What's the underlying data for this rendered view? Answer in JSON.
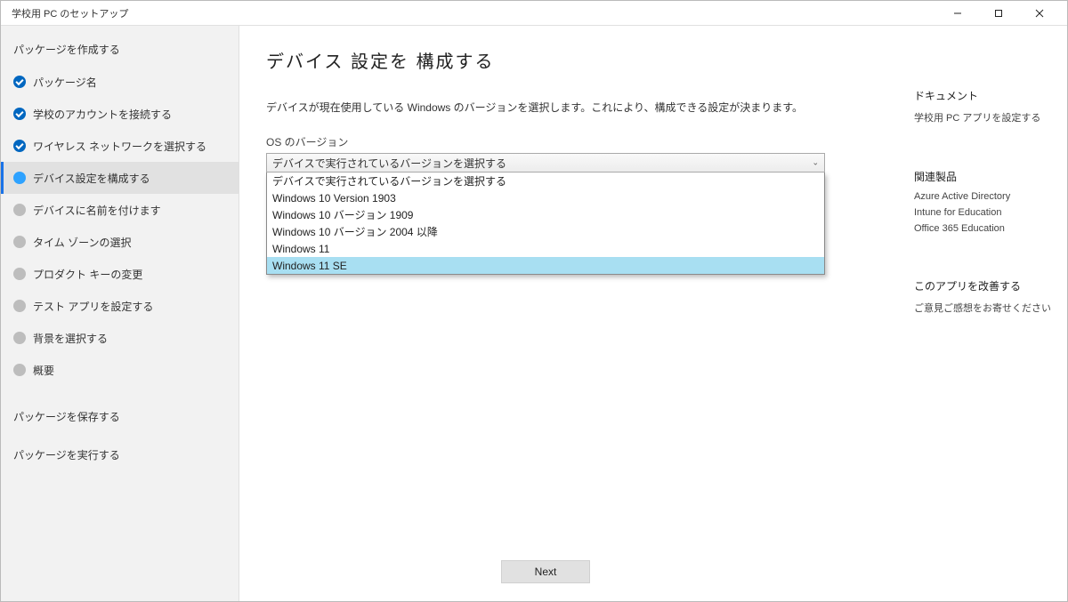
{
  "window": {
    "title": "学校用 PC のセットアップ"
  },
  "sidebar": {
    "section_create": "パッケージを作成する",
    "items": [
      {
        "label": "パッケージ名",
        "state": "done"
      },
      {
        "label": "学校のアカウントを接続する",
        "state": "done"
      },
      {
        "label": "ワイヤレス ネットワークを選択する",
        "state": "done"
      },
      {
        "label": "デバイス設定を構成する",
        "state": "current"
      },
      {
        "label": "デバイスに名前を付けます",
        "state": "pending"
      },
      {
        "label": "タイム ゾーンの選択",
        "state": "pending"
      },
      {
        "label": "プロダクト キーの変更",
        "state": "pending"
      },
      {
        "label": "テスト アプリを設定する",
        "state": "pending"
      },
      {
        "label": "背景を選択する",
        "state": "pending"
      },
      {
        "label": "概要",
        "state": "pending"
      }
    ],
    "section_save": "パッケージを保存する",
    "section_run": "パッケージを実行する"
  },
  "main": {
    "title": "デバイス 設定を 構成する",
    "desc": "デバイスが現在使用している Windows のバージョンを選択します。これにより、構成できる設定が決まります。",
    "field_label": "OS のバージョン",
    "combo_value": "デバイスで実行されているバージョンを選択する",
    "options": [
      "デバイスで実行されているバージョンを選択する",
      "Windows 10 Version 1903",
      "Windows 10 バージョン 1909",
      "Windows 10 バージョン 2004 以降",
      "Windows 11",
      "Windows 11 SE"
    ],
    "highlight_index": 5,
    "next_label": "Next"
  },
  "rightpane": {
    "doc_heading": "ドキュメント",
    "doc_link": "学校用 PC アプリを設定する",
    "related_heading": "関連製品",
    "related": [
      "Azure Active Directory",
      "Intune for Education",
      "Office 365 Education"
    ],
    "improve_heading": "このアプリを改善する",
    "improve_link": "ご意見ご感想をお寄せください"
  }
}
